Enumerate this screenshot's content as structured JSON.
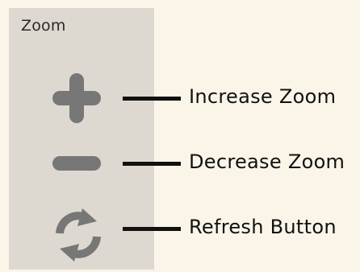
{
  "zoom_panel": {
    "title": "Zoom",
    "tools": [
      {
        "icon": "plus-icon",
        "label": "Increase Zoom"
      },
      {
        "icon": "minus-icon",
        "label": "Decrease Zoom"
      },
      {
        "icon": "refresh-icon",
        "label": "Refresh Button"
      }
    ]
  },
  "colors": {
    "background": "#faf5e8",
    "panel": "#ddd9d1",
    "icon": "#777777",
    "line": "#111111"
  }
}
